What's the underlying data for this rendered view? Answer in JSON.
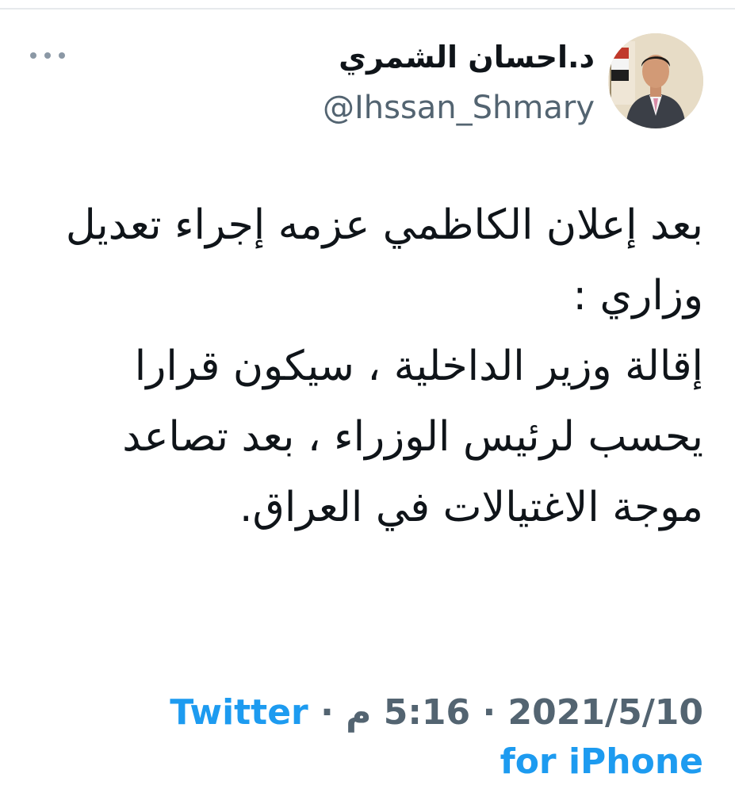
{
  "tweet": {
    "display_name": "د.احسان الشمري",
    "handle": "@Ihssan_Shmary",
    "text": "بعد إعلان الكاظمي عزمه إجراء تعديل وزاري :\n إقالة وزير الداخلية ، سيكون قرارا يحسب لرئيس الوزراء ، بعد تصاعد موجة الاغتيالات في العراق.",
    "date": "2021/5/10",
    "separator": "·",
    "time": "5:16 م",
    "source": "Twitter for iPhone"
  },
  "icons": {
    "more": "more-horizontal-icon"
  },
  "colors": {
    "text": "#0f1419",
    "secondary": "#536471",
    "link": "#1d9bf0"
  }
}
